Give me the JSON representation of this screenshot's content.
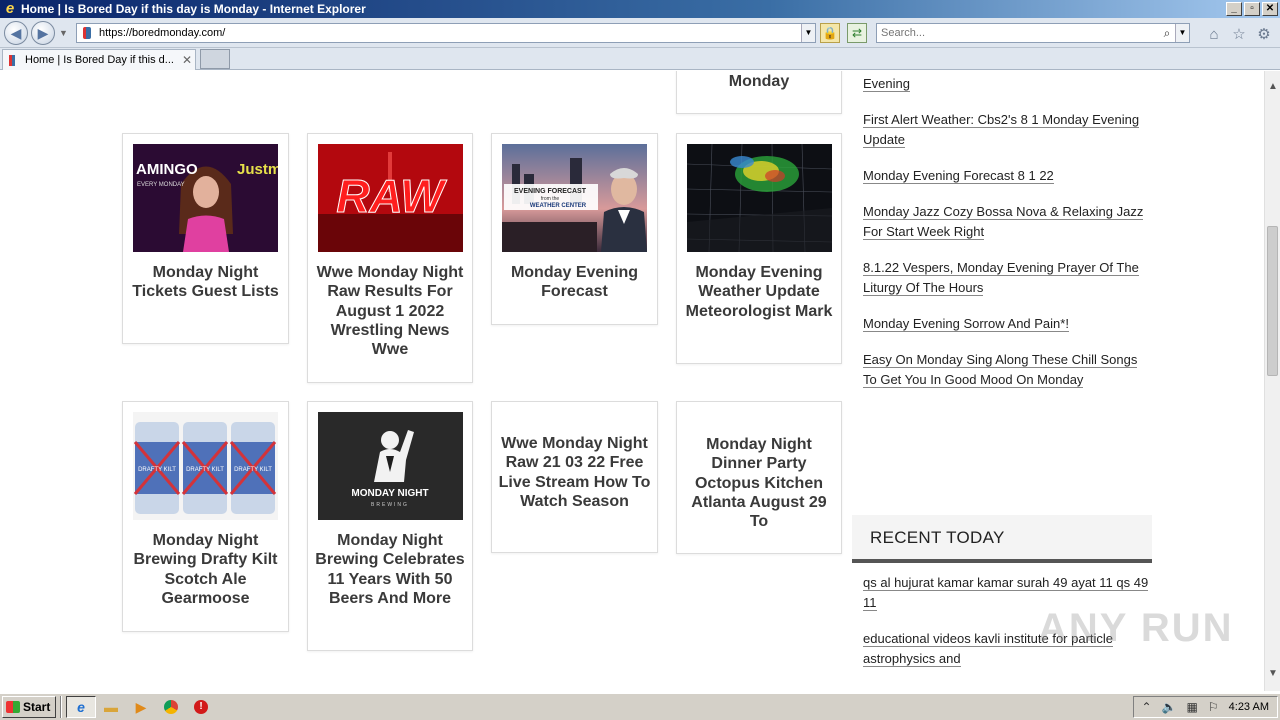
{
  "window": {
    "title": "Home | Is Bored Day if this day is Monday - Internet Explorer",
    "min": "_",
    "max": "▫",
    "close": "✕"
  },
  "nav": {
    "url": "https://boredmonday.com/",
    "search_placeholder": "Search..."
  },
  "tabs": [
    {
      "label": "Home | Is Bored Day if this d..."
    }
  ],
  "cards": [
    {
      "title": "Monday",
      "thumb": "none"
    },
    {
      "title": "Monday Night Tickets Guest Lists",
      "thumb": "woman-pink"
    },
    {
      "title": "Wwe Monday Night Raw Results For August 1 2022 Wrestling News Wwe",
      "thumb": "raw-logo"
    },
    {
      "title": "Monday Evening Forecast",
      "thumb": "city-forecast"
    },
    {
      "title": "Monday Evening Weather Update Meteorologist Mark",
      "thumb": "radar-map"
    },
    {
      "title": "Monday Night Brewing Drafty Kilt Scotch Ale Gearmoose",
      "thumb": "beer-cans"
    },
    {
      "title": "Monday Night Brewing Celebrates 11 Years With 50 Beers And More",
      "thumb": "brewing-logo"
    },
    {
      "title": "Wwe Monday Night Raw 21 03 22 Free Live Stream How To Watch Season",
      "thumb": "none"
    },
    {
      "title": "Monday Night Dinner Party Octopus Kitchen Atlanta August 29 To",
      "thumb": "none"
    }
  ],
  "thumb_text": {
    "woman_left": "AMINGO",
    "woman_right": "Justm",
    "woman_sub": "EVERY MONDAY",
    "raw": "RAW",
    "forecast_line1": "EVENING FORECAST",
    "forecast_line2": "from the",
    "forecast_line3": "WEATHER CENTER",
    "can_label": "DRAFTY KILT",
    "brewing_line1": "MONDAY NIGHT",
    "brewing_line2": "BREWING"
  },
  "sidebar": {
    "links_top": [
      "Evening",
      "First Alert Weather: Cbs2's 8 1 Monday Evening Update",
      "Monday Evening Forecast 8 1 22",
      "Monday Jazz Cozy Bossa Nova & Relaxing Jazz For Start Week Right",
      "8.1.22 Vespers, Monday Evening Prayer Of The Liturgy Of The Hours",
      "Monday Evening Sorrow And Pain*!",
      "Easy On Monday Sing Along These Chill Songs To Get You In Good Mood On Monday"
    ],
    "recent_heading": "RECENT TODAY",
    "recent_links": [
      "qs al hujurat kamar kamar surah 49 ayat 11 qs 49 11",
      "educational videos kavli institute for particle astrophysics and"
    ]
  },
  "watermark": "ANY RUN",
  "taskbar": {
    "start": "Start",
    "clock": "4:23 AM"
  }
}
